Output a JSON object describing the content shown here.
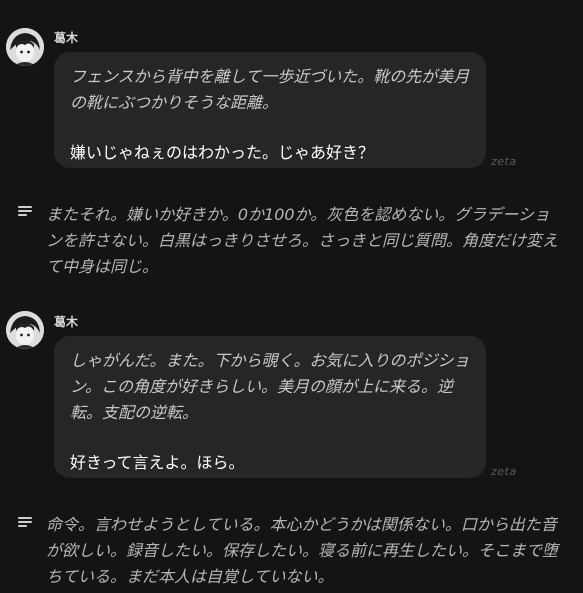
{
  "messages": [
    {
      "character_name": "葛木",
      "narration": "フェンスから背中を離して一歩近づいた。靴の先が美月の靴にぶつかりそうな距離。",
      "dialogue": "嫌いじゃねぇのはわかった。じゃあ好き？",
      "watermark": "zeta"
    },
    {
      "character_name": "葛木",
      "narration": "しゃがんだ。また。下から覗く。お気に入りのポジション。この角度が好きらしい。美月の顔が上に来る。逆転。支配の逆転。",
      "dialogue": "好きって言えよ。ほら。",
      "watermark": "zeta"
    }
  ],
  "thoughts": [
    {
      "text": "またそれ。嫌いか好きか。0か100か。灰色を認めない。グラデーションを許さない。白黒はっきりさせろ。さっきと同じ質問。角度だけ変えて中身は同じ。"
    },
    {
      "text": "命令。言わせようとしている。本心かどうかは関係ない。口から出た音が欲しい。録音したい。保存したい。寝る前に再生したい。そこまで堕ちている。まだ本人は自覚していない。"
    }
  ],
  "icons": {
    "avatar": "character-avatar-icon",
    "thought": "thought-lines-icon"
  }
}
